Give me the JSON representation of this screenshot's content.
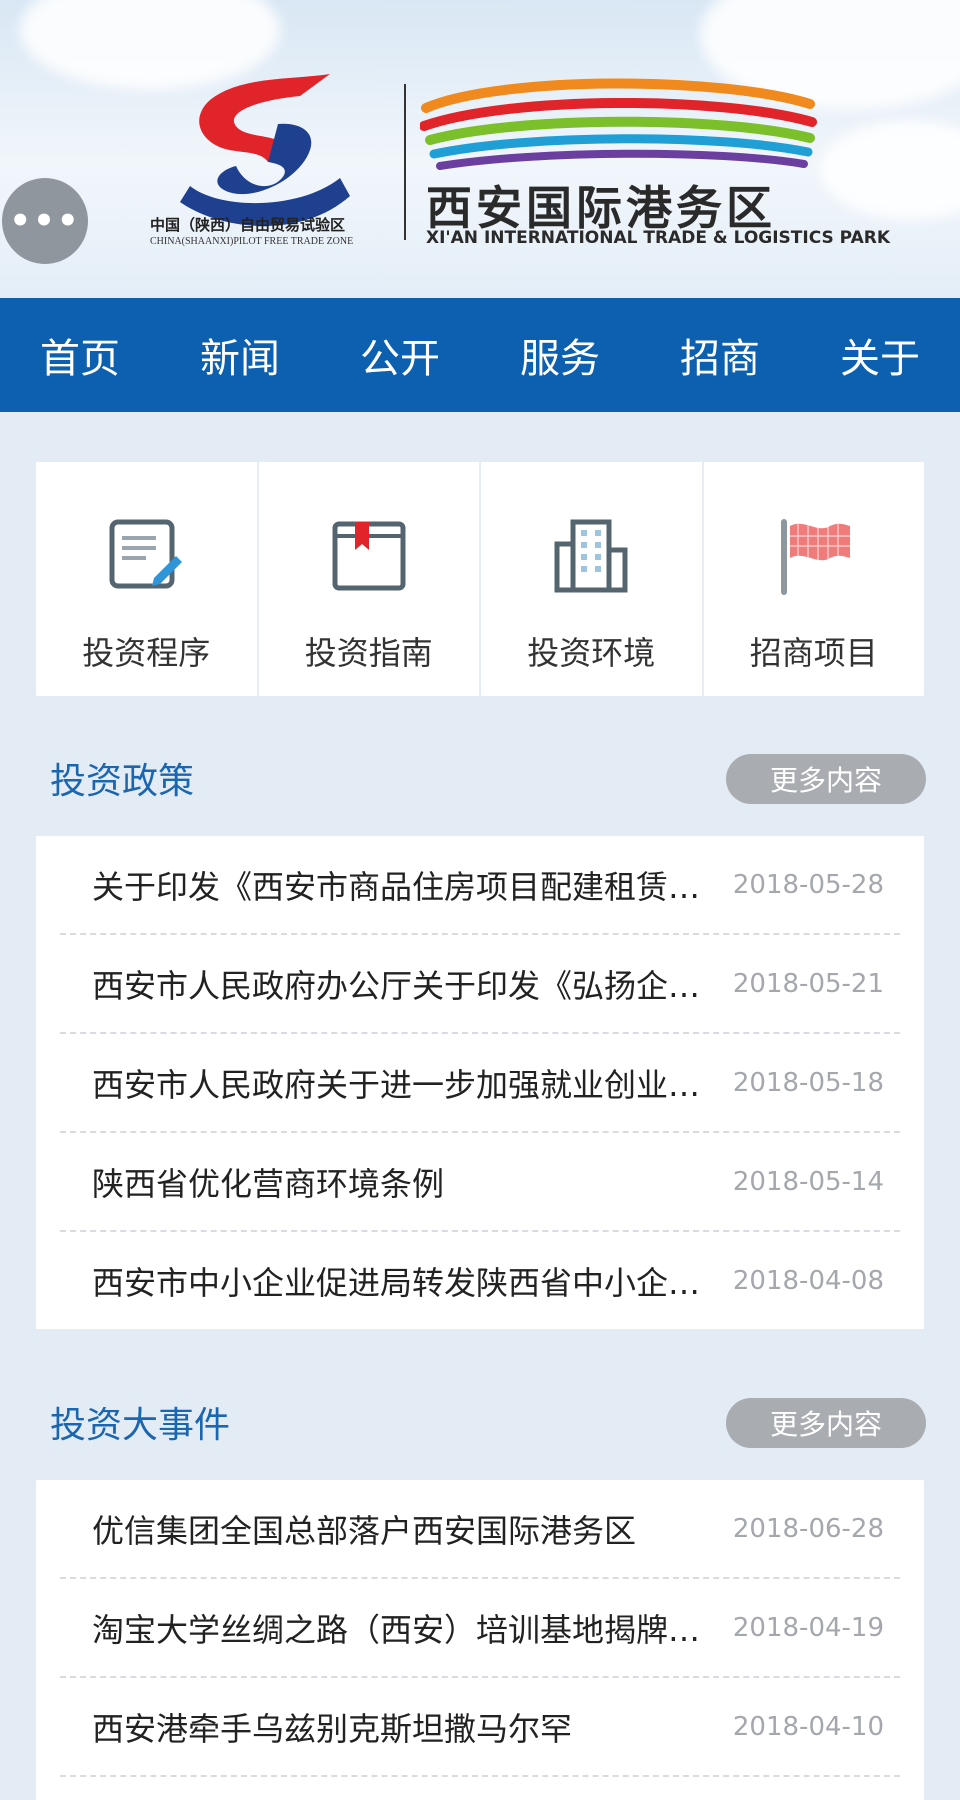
{
  "header": {
    "menu_icon": "more-dots-icon",
    "left_logo_cn": "中国（陕西）自由贸易试验区",
    "left_logo_en": "CHINA(SHAANXI)PILOT FREE TRADE ZONE",
    "park_name_cn": "西安国际港务区",
    "park_name_en": "XI'AN INTERNATIONAL TRADE & LOGISTICS PARK"
  },
  "nav": {
    "items": [
      "首页",
      "新闻",
      "公开",
      "服务",
      "招商",
      "关于"
    ]
  },
  "quick_links": [
    {
      "label": "投资程序",
      "icon": "document-edit-icon"
    },
    {
      "label": "投资指南",
      "icon": "bookmark-book-icon"
    },
    {
      "label": "投资环境",
      "icon": "buildings-icon"
    },
    {
      "label": "招商项目",
      "icon": "flag-icon"
    }
  ],
  "sections": [
    {
      "title": "投资政策",
      "more_label": "更多内容",
      "items": [
        {
          "title": "关于印发《西安市商品住房项目配建租赁住房管理办法》的通知",
          "date": "2018-05-28"
        },
        {
          "title": "西安市人民政府办公厅关于印发《弘扬企业家精神实施意见》的通知",
          "date": "2018-05-21"
        },
        {
          "title": "西安市人民政府关于进一步加强就业创业工作的实施意见",
          "date": "2018-05-18"
        },
        {
          "title": "陕西省优化营商环境条例",
          "date": "2018-05-14"
        },
        {
          "title": "西安市中小企业促进局转发陕西省中小企业促进局相关通知",
          "date": "2018-04-08"
        }
      ]
    },
    {
      "title": "投资大事件",
      "more_label": "更多内容",
      "items": [
        {
          "title": "优信集团全国总部落户西安国际港务区",
          "date": "2018-06-28"
        },
        {
          "title": "淘宝大学丝绸之路（西安）培训基地揭牌成立",
          "date": "2018-04-19"
        },
        {
          "title": "西安港牵手乌兹别克斯坦撒马尔罕",
          "date": "2018-04-10"
        }
      ]
    }
  ],
  "colors": {
    "nav_bg": "#0d5fb0",
    "section_title": "#1a66b0",
    "page_bg": "#e3ebf5",
    "more_btn": "#a9adb2",
    "date_text": "#a4a8ad"
  }
}
